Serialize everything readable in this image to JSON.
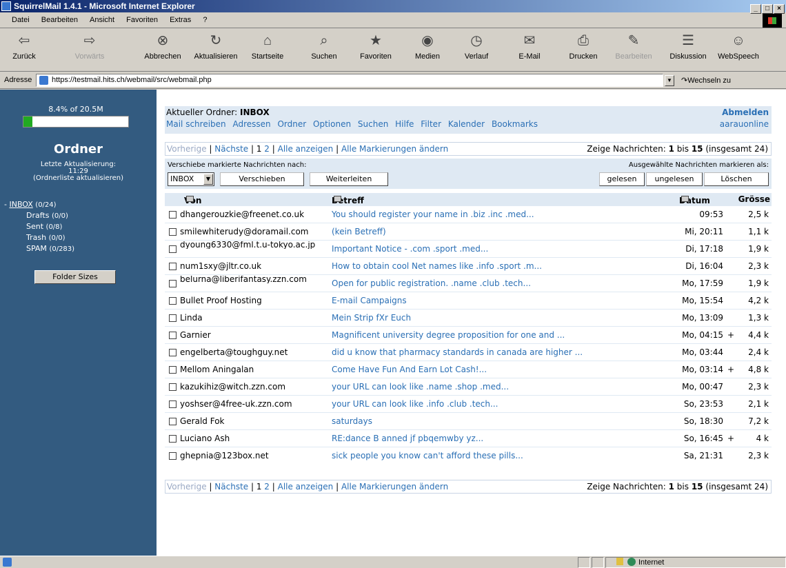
{
  "window": {
    "title": "SquirrelMail 1.4.1 - Microsoft Internet Explorer",
    "buttons": [
      "_",
      "□",
      "×"
    ]
  },
  "menubar": [
    "Datei",
    "Bearbeiten",
    "Ansicht",
    "Favoriten",
    "Extras",
    "?"
  ],
  "toolbar": [
    {
      "label": "Zurück",
      "icon": "⇦"
    },
    {
      "label": "Vorwärts",
      "icon": "⇨"
    },
    {
      "label": "Abbrechen",
      "icon": "⊗"
    },
    {
      "label": "Aktualisieren",
      "icon": "↻"
    },
    {
      "label": "Startseite",
      "icon": "⌂"
    },
    {
      "label": "Suchen",
      "icon": "⌕"
    },
    {
      "label": "Favoriten",
      "icon": "★"
    },
    {
      "label": "Medien",
      "icon": "◉"
    },
    {
      "label": "Verlauf",
      "icon": "◷"
    },
    {
      "label": "E-Mail",
      "icon": "✉"
    },
    {
      "label": "Drucken",
      "icon": "⎙"
    },
    {
      "label": "Bearbeiten",
      "icon": "✎"
    },
    {
      "label": "Diskussion",
      "icon": "☰"
    },
    {
      "label": "WebSpeech",
      "icon": "☺"
    }
  ],
  "address": {
    "label": "Adresse",
    "url": "https://testmail.hits.ch/webmail/src/webmail.php",
    "go": "Wechseln zu"
  },
  "sidebar": {
    "quota_text": "8.4% of 20.5M",
    "quota_percent": 8.4,
    "title": "Ordner",
    "last_update_label": "Letzte Aktualisierung:",
    "last_update_time": "11:29",
    "refresh_link": "(Ordnerliste aktualisieren)",
    "folders": [
      {
        "name": "INBOX",
        "count": "(0/24)"
      },
      {
        "name": "Drafts",
        "count": "(0/0)"
      },
      {
        "name": "Sent",
        "count": "(0/8)"
      },
      {
        "name": "Trash",
        "count": "(0/0)"
      },
      {
        "name": "SPAM",
        "count": "(0/283)"
      }
    ],
    "folder_sizes_button": "Folder Sizes"
  },
  "header": {
    "current_folder_label": "Aktueller Ordner:",
    "current_folder": "INBOX",
    "signout": "Abmelden",
    "menu": [
      "Mail schreiben",
      "Adressen",
      "Ordner",
      "Optionen",
      "Suchen",
      "Hilfe",
      "Filter",
      "Kalender",
      "Bookmarks"
    ],
    "server": "aarauonline"
  },
  "pager": {
    "prev": "Vorherige",
    "next": "Nächste",
    "pages": [
      "1",
      "2"
    ],
    "show_all": "Alle anzeigen",
    "toggle_all": "Alle Markierungen ändern",
    "summary_prefix": "Zeige Nachrichten:",
    "first": "1",
    "bis": "bis",
    "last": "15",
    "total": "(insgesamt 24)"
  },
  "actions": {
    "move_label": "Verschiebe markierte Nachrichten nach:",
    "move_target": "INBOX",
    "move_button": "Verschieben",
    "forward_button": "Weiterleiten",
    "mark_label": "Ausgewählte Nachrichten markieren als:",
    "read_button": "gelesen",
    "unread_button": "ungelesen",
    "delete_button": "Löschen"
  },
  "columns": {
    "from": "Von",
    "subject": "Betreff",
    "date": "Datum",
    "size": "Grösse"
  },
  "messages": [
    {
      "from": "dhangerouzkie@freenet.co.uk",
      "subject": "You should register your name in .biz .inc .med...",
      "date": "09:53",
      "flag": "",
      "size": "2,5 k"
    },
    {
      "from": "smilewhiterudy@doramail.com",
      "subject": "(kein Betreff)",
      "date": "Mi, 20:11",
      "flag": "",
      "size": "1,1 k"
    },
    {
      "from": "dyoung6330@fml.t.u-tokyo.ac.jp",
      "subject": "Important Notice - .com .sport .med...",
      "date": "Di, 17:18",
      "flag": "",
      "size": "1,9 k"
    },
    {
      "from": "num1sxy@jltr.co.uk",
      "subject": "How to obtain cool Net names like .info .sport .m...",
      "date": "Di, 16:04",
      "flag": "",
      "size": "2,3 k"
    },
    {
      "from": "belurna@liberifantasy.zzn.com",
      "subject": "Open for public registration. .name .club .tech...",
      "date": "Mo, 17:59",
      "flag": "",
      "size": "1,9 k"
    },
    {
      "from": "Bullet Proof Hosting",
      "subject": "E-mail Campaigns",
      "date": "Mo, 15:54",
      "flag": "",
      "size": "4,2 k"
    },
    {
      "from": "Linda",
      "subject": "Mein Strip fXr Euch",
      "date": "Mo, 13:09",
      "flag": "",
      "size": "1,3 k"
    },
    {
      "from": "Garnier",
      "subject": "Magnificent university degree proposition for one and ...",
      "date": "Mo, 04:15",
      "flag": "+",
      "size": "4,4 k"
    },
    {
      "from": "engelberta@toughguy.net",
      "subject": "did u know that pharmacy standards in canada are higher ...",
      "date": "Mo, 03:44",
      "flag": "",
      "size": "2,4 k"
    },
    {
      "from": "Mellom Aningalan",
      "subject": "Come Have Fun And Earn Lot Cash!...",
      "date": "Mo, 03:14",
      "flag": "+",
      "size": "4,8 k"
    },
    {
      "from": "kazukihiz@witch.zzn.com",
      "subject": "your URL can look like .name .shop .med...",
      "date": "Mo, 00:47",
      "flag": "",
      "size": "2,3 k"
    },
    {
      "from": "yoshser@4free-uk.zzn.com",
      "subject": "your URL can look like .info .club .tech...",
      "date": "So, 23:53",
      "flag": "",
      "size": "2,1 k"
    },
    {
      "from": "Gerald Fok",
      "subject": "saturdays",
      "date": "So, 18:30",
      "flag": "",
      "size": "7,2 k"
    },
    {
      "from": "Luciano Ash",
      "subject": "RE:dance B anned jf pbqemwby yz...",
      "date": "So, 16:45",
      "flag": "+",
      "size": "4 k"
    },
    {
      "from": "ghepnia@123box.net",
      "subject": "sick people you know can't afford these pills...",
      "date": "Sa, 21:31",
      "flag": "",
      "size": "2,3 k"
    }
  ],
  "statusbar": {
    "zone": "Internet"
  },
  "colors": {
    "sidebar_bg": "#335b80",
    "header_bg": "#dfe9f3",
    "link": "#2a6fb5",
    "quota_fill": "#22aa22"
  }
}
